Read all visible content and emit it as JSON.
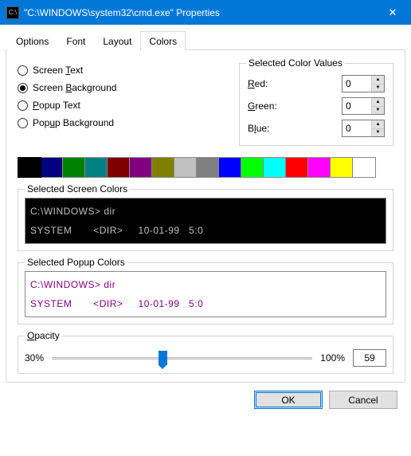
{
  "title": "\"C:\\WINDOWS\\system32\\cmd.exe\" Properties",
  "tabs": [
    "Options",
    "Font",
    "Layout",
    "Colors"
  ],
  "active_tab": 3,
  "radios": {
    "items": [
      {
        "label_pre": "Screen ",
        "key": "T",
        "label_post": "ext"
      },
      {
        "label_pre": "Screen ",
        "key": "B",
        "label_post": "ackground"
      },
      {
        "label_pre": "",
        "key": "P",
        "label_post": "opup Text"
      },
      {
        "label_pre": "Pop",
        "key": "u",
        "label_post": "p Background"
      }
    ],
    "selected": 1
  },
  "color_values": {
    "title": "Selected Color Values",
    "rows": [
      {
        "label_pre": "",
        "key": "R",
        "label_post": "ed:",
        "value": "0"
      },
      {
        "label_pre": "",
        "key": "G",
        "label_post": "reen:",
        "value": "0"
      },
      {
        "label_pre": "B",
        "key": "l",
        "label_post": "ue:",
        "value": "0",
        "keypre": "B"
      }
    ]
  },
  "palette": [
    "#000000",
    "#000080",
    "#008000",
    "#008080",
    "#800000",
    "#800080",
    "#808000",
    "#c0c0c0",
    "#808080",
    "#0000ff",
    "#00ff00",
    "#00ffff",
    "#ff0000",
    "#ff00ff",
    "#ffff00",
    "#ffffff"
  ],
  "palette_selected": 0,
  "screen_colors": {
    "title": "Selected Screen Colors",
    "line1": "C:\\WINDOWS> dir",
    "line2": "SYSTEM       <DIR>     10-01-99   5:0"
  },
  "popup_colors": {
    "title": "Selected Popup Colors",
    "line1": "C:\\WINDOWS> dir",
    "line2": "SYSTEM       <DIR>     10-01-99   5:0"
  },
  "opacity": {
    "title_pre": "",
    "key": "O",
    "title_post": "pacity",
    "min_label": "30%",
    "max_label": "100%",
    "value": "59",
    "thumb_percent": 41
  },
  "buttons": {
    "ok": "OK",
    "cancel": "Cancel"
  }
}
